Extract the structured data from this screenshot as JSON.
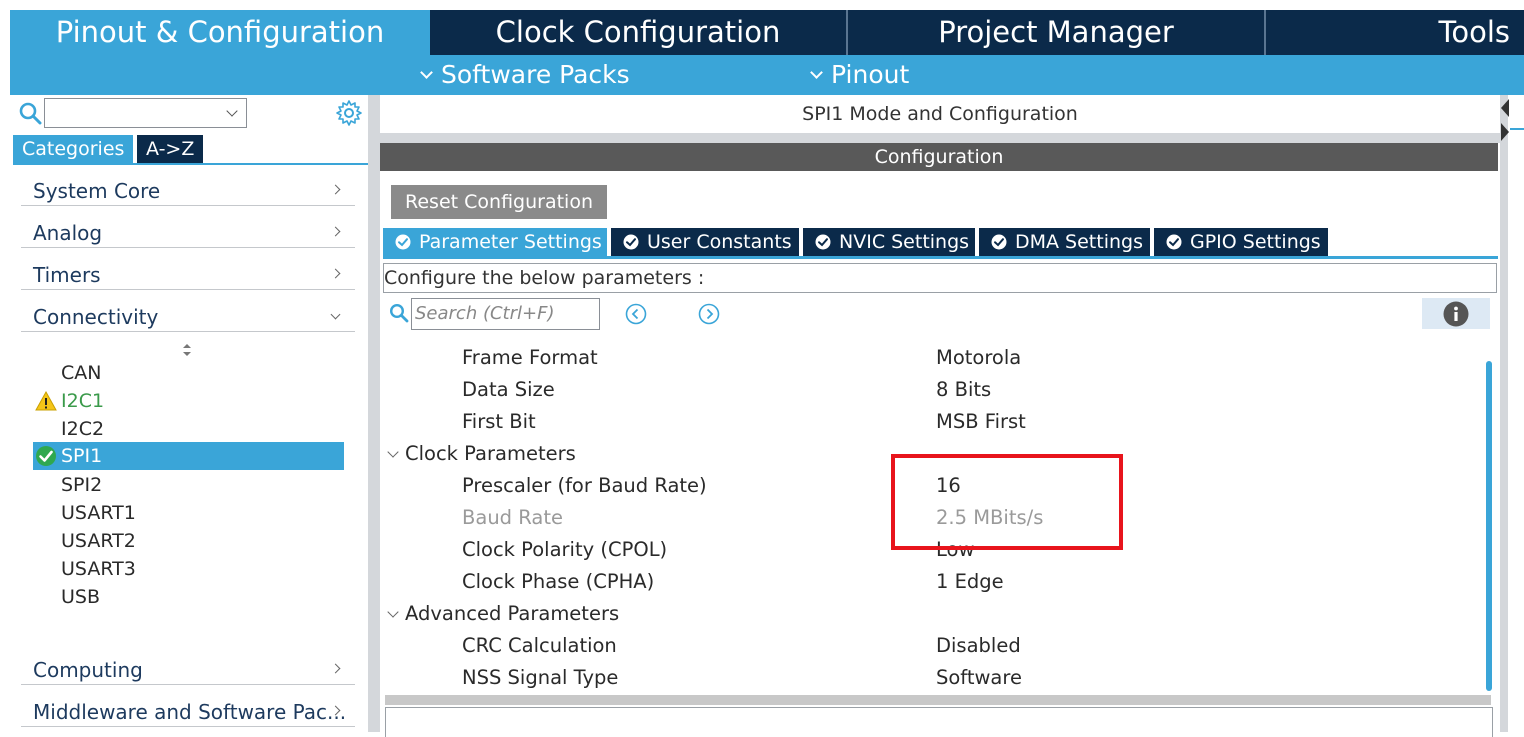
{
  "top_tabs": [
    "Pinout & Configuration",
    "Clock Configuration",
    "Project Manager",
    "Tools"
  ],
  "sub_menu": {
    "software_packs": "Software Packs",
    "pinout": "Pinout"
  },
  "left": {
    "category_tab": "Categories",
    "az_tab": "A->Z",
    "categories": [
      "System Core",
      "Analog",
      "Timers",
      "Connectivity"
    ],
    "peripherals": [
      "CAN",
      "I2C1",
      "I2C2",
      "SPI1",
      "SPI2",
      "USART1",
      "USART2",
      "USART3",
      "USB"
    ],
    "bottom_categories": [
      "Computing",
      "Middleware and Software Pac..."
    ]
  },
  "right": {
    "mode_title": "SPI1 Mode and Configuration",
    "config_title": "Configuration",
    "reset_button": "Reset Configuration",
    "param_tabs": [
      "Parameter Settings",
      "User Constants",
      "NVIC Settings",
      "DMA Settings",
      "GPIO Settings"
    ],
    "configure_text": "Configure the below parameters :",
    "search_placeholder": "Search (Ctrl+F)",
    "params": [
      {
        "name": "Frame Format",
        "value": "Motorola"
      },
      {
        "name": "Data Size",
        "value": "8 Bits"
      },
      {
        "name": "First Bit",
        "value": "MSB First"
      },
      {
        "name": "Clock Parameters",
        "value": ""
      },
      {
        "name": "Prescaler (for Baud Rate)",
        "value": "16"
      },
      {
        "name": "Baud Rate",
        "value": "2.5 MBits/s"
      },
      {
        "name": "Clock Polarity (CPOL)",
        "value": "Low"
      },
      {
        "name": "Clock Phase (CPHA)",
        "value": "1 Edge"
      },
      {
        "name": "Advanced Parameters",
        "value": ""
      },
      {
        "name": "CRC Calculation",
        "value": "Disabled"
      },
      {
        "name": "NSS Signal Type",
        "value": "Software"
      }
    ]
  },
  "colors": {
    "navy": "#0b2a4a",
    "accent": "#3aa5d8",
    "highlight_box": "#e8141c",
    "warning": "#f5c518",
    "ok": "#2fa84f"
  }
}
